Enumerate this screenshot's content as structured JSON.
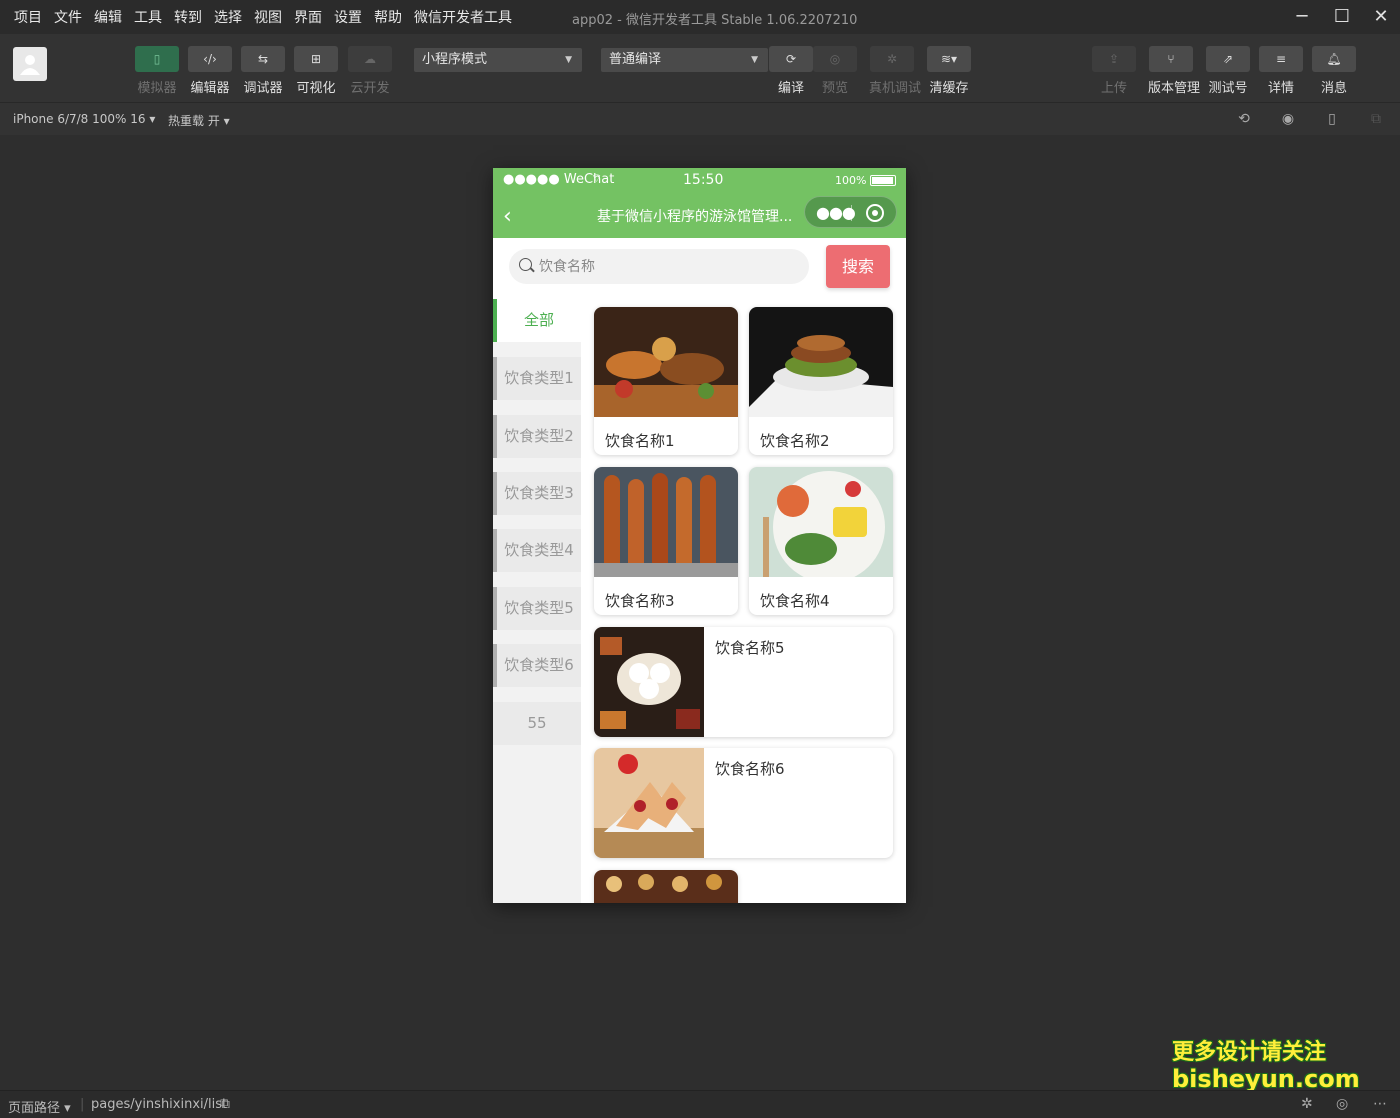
{
  "menu": [
    "项目",
    "文件",
    "编辑",
    "工具",
    "转到",
    "选择",
    "视图",
    "界面",
    "设置",
    "帮助",
    "微信开发者工具"
  ],
  "window_title": "app02 - 微信开发者工具 Stable 1.06.2207210",
  "toolbar": {
    "simulator": "模拟器",
    "editor": "编辑器",
    "debugger": "调试器",
    "visual": "可视化",
    "cloud": "云开发",
    "mode_select": "小程序模式",
    "compile_select": "普通编译",
    "compile": "编译",
    "preview": "预览",
    "device_debug": "真机调试",
    "clear_cache": "清缓存",
    "upload": "上传",
    "version": "版本管理",
    "test_account": "测试号",
    "details": "详情",
    "messages": "消息"
  },
  "strip": {
    "device": "iPhone 6/7/8 100% 16 ▾",
    "hot_reload": "热重载 开 ▾"
  },
  "phone": {
    "carrier": "●●●●● WeChat",
    "time": "15:50",
    "battery": "100%",
    "page_title": "基于微信小程序的游泳馆管理...",
    "search_placeholder": "饮食名称",
    "search_button": "搜索",
    "categories": [
      "全部",
      "饮食类型1",
      "饮食类型2",
      "饮食类型3",
      "饮食类型4",
      "饮食类型5",
      "饮食类型6",
      "55"
    ],
    "items": [
      "饮食名称1",
      "饮食名称2",
      "饮食名称3",
      "饮食名称4",
      "饮食名称5",
      "饮食名称6"
    ]
  },
  "footer": {
    "path_label": "页面路径 ▾",
    "path": "pages/yinshixinxi/list"
  },
  "watermark": {
    "line1": "更多设计请关注",
    "line2": "bisheyun.com"
  },
  "colors": {
    "nav_green": "#74c263",
    "search_red": "#ed6d72",
    "active_green": "#4caf50"
  }
}
